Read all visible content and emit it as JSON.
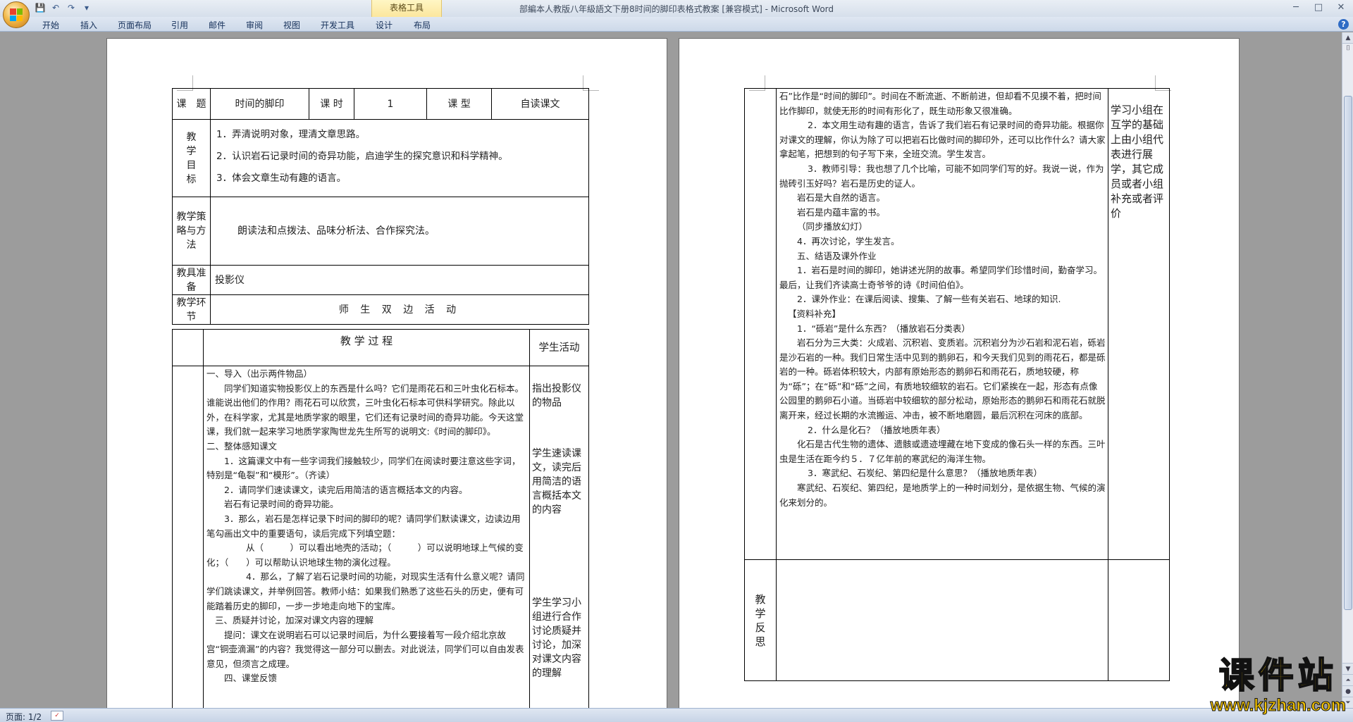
{
  "window": {
    "title": "部編本人教版八年級語文下册8时间的脚印表格式教案 [兼容模式] - Microsoft Word",
    "table_tools": "表格工具",
    "controls": [
      "─",
      "□",
      "✕"
    ]
  },
  "qat": {
    "save": "💾",
    "undo": "↶",
    "redo": "↷",
    "more": "▾"
  },
  "ribbon": {
    "tabs": [
      "开始",
      "插入",
      "页面布局",
      "引用",
      "邮件",
      "审阅",
      "视图",
      "开发工具",
      "设计",
      "布局"
    ],
    "help": "?"
  },
  "status": {
    "page": "页面: 1/2"
  },
  "watermark": {
    "line1": "课件站",
    "line2": "www.kjzhan.com"
  },
  "page1": {
    "header": {
      "l1": "课　题",
      "title": "时间的脚印",
      "l2": "课 时",
      "hours": "1",
      "l3": "课 型",
      "type": "自读课文"
    },
    "goals": {
      "label": "教\n学\n目\n标",
      "items": [
        "1．弄清说明对象，理清文章思路。",
        "2．认识岩石记录时间的奇异功能，启迪学生的探究意识和科学精神。",
        "3．体会文章生动有趣的语言。"
      ]
    },
    "strategy": {
      "label": "教学策\n略与方\n法",
      "text": "朗读法和点拨法、品味分析法、合作探究法。"
    },
    "tools": {
      "label": "教具准\n备",
      "text": "投影仪"
    },
    "link": {
      "label": "教学环\n节",
      "text": "师 生 双 边 活 动"
    },
    "process_header": {
      "title": "教 学 过 程",
      "student": "学生活动"
    },
    "process": [
      "一、导入（出示两件物品）",
      "同学们知道实物投影仪上的东西是什么吗？它们是雨花石和三叶虫化石标本。谁能说出他们的作用？雨花石可以欣赏，三叶虫化石标本可供科学研究。除此以外，在科学家，尤其是地质学家的眼里，它们还有记录时间的奇异功能。今天这堂课，我们就一起来学习地质学家陶世龙先生所写的说明文:《时间的脚印》。",
      "二、整体感知课文",
      "1．这篇课文中有一些字词我们接触较少，同学们在阅读时要注意这些字词，特别是“龟裂”和“模形”。（齐读）",
      "2．请同学们速读课文，读完后用简洁的语言概括本文的内容。",
      "岩石有记录时间的奇异功能。",
      "3．那么，岩石是怎样记录下时间的脚印的呢？请同学们默读课文，边读边用笔勾画出文中的重要语句，读后完成下列填空题：",
      "从（　　　）可以看出地壳的活动；（　　　）可以说明地球上气候的变化；（　　）可以帮助认识地球生物的演化过程。",
      "4．那么，了解了岩石记录时间的功能，对现实生活有什么意义呢？请同学们跳读课文，并举例回答。教师小结：如果我们熟悉了这些石头的历史，便有可能踏着历史的脚印，一步一步地走向地下的宝库。",
      "三、质疑并讨论，加深对课文内容的理解",
      "提问：课文在说明岩石可以记录时间后，为什么要接着写一段介绍北京故宫“铜壶滴漏”的内容？我觉得这一部分可以删去。对此说法，同学们可以自由发表意见，但须言之成理。",
      "四、课堂反馈"
    ],
    "student": [
      "指出投影仪的物品",
      "学生速读课文，读完后用简洁的语言概括本文的内容",
      "学生学习小组进行合作讨论质疑并讨论，加深对课文内容的理解"
    ]
  },
  "page2": {
    "process": [
      "石”比作是“时间的脚印”。时间在不断流逝、不断前进，但却看不见摸不着，把时间比作脚印，就使无形的时间有形化了，既生动形象又很准确。",
      "2．本文用生动有趣的语言，告诉了我们岩石有记录时间的奇异功能。根据你对课文的理解，你认为除了可以把岩石比做时间的脚印外，还可以比作什么？请大家拿起笔，把想到的句子写下来，全班交流。学生发言。",
      "3．教师引导：我也想了几个比喻，可能不如同学们写的好。我说一说，作为抛砖引玉好吗？岩石是历史的证人。",
      "岩石是大自然的语言。",
      "岩石是内蕴丰富的书。",
      "（同步播放幻灯）",
      "4．再次讨论，学生发言。",
      "五、结语及课外作业",
      "1．岩石是时间的脚印，她讲述光阴的故事。希望同学们珍惜时间，勤奋学习。最后，让我们齐读高士奇爷爷的诗《时间伯伯》。",
      "2．课外作业：在课后阅读、搜集、了解一些有关岩石、地球的知识.",
      "【资料补充】",
      "1．“砾岩”是什么东西？（播放岩石分类表）",
      "岩石分为三大类：火成岩、沉积岩、变质岩。沉积岩分为沙石岩和泥石岩，砾岩是沙石岩的一种。我们日常生活中见到的鹅卵石，和今天我们见到的雨花石，都是砾岩的一种。砾岩体积较大，内部有原始形态的鹅卵石和雨花石，质地较硬，称为“砾”；在“砾”和“砾”之间，有质地较细软的岩石。它们紧挨在一起，形态有点像公园里的鹅卵石小道。当砾岩中较细软的部分松动，原始形态的鹅卵石和雨花石就脱离开来，经过长期的水流搬运、冲击，被不断地磨圆，最后沉积在河床的底部。",
      "2．什么是化石？（播放地质年表）",
      "化石是古代生物的遗体、遗骸或遗迹埋藏在地下变成的像石头一样的东西。三叶虫是生活在距今约５．７亿年前的寒武纪的海洋生物。",
      "3．寒武纪、石炭纪、第四纪是什么意思？（播放地质年表）",
      "寒武纪、石炭纪、第四纪，是地质学上的一种时间划分，是依据生物、气候的演化来划分的。"
    ],
    "student": "学习小组在互学的基础上由小组代表进行展学，其它成员或者小组补充或者评价",
    "reflect_label": "教\n学\n反\n思"
  }
}
